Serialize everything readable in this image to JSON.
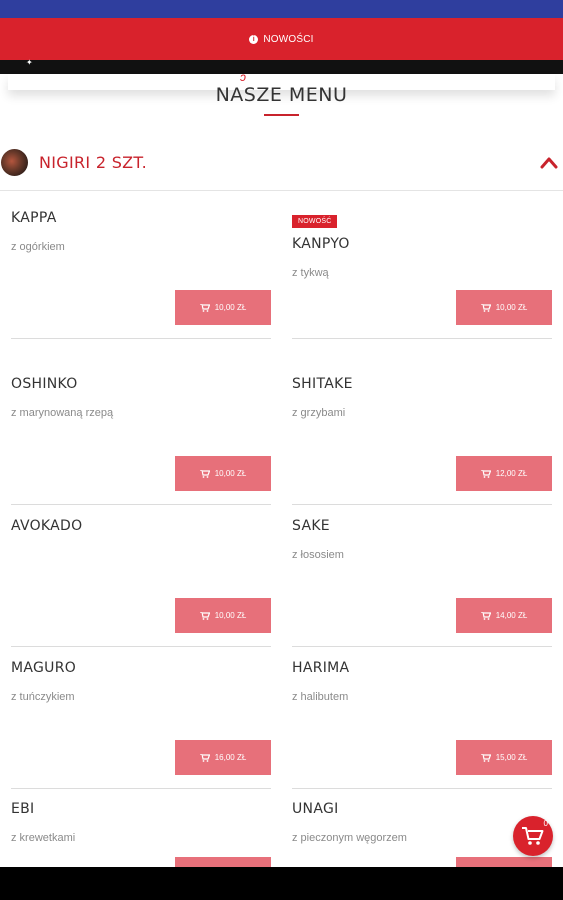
{
  "notice": {
    "text": "NOWOŚCI",
    "icon": "info-icon"
  },
  "header": {
    "title": "NASZE MENU"
  },
  "section": {
    "title": "NIGIRI 2 SZT.",
    "expanded": true
  },
  "items": [
    {
      "name": "KAPPA",
      "desc": "z ogórkiem",
      "price": "10,00 ZŁ",
      "badge": ""
    },
    {
      "name": "KANPYO",
      "desc": "z tykwą",
      "price": "10,00 ZŁ",
      "badge": "NOWOŚĆ"
    },
    {
      "name": "OSHINKO",
      "desc": "z marynowaną rzepą",
      "price": "10,00 ZŁ",
      "badge": ""
    },
    {
      "name": "SHITAKE",
      "desc": "z grzybami",
      "price": "12,00 ZŁ",
      "badge": ""
    },
    {
      "name": "AVOKADO",
      "desc": "",
      "price": "10,00 ZŁ",
      "badge": ""
    },
    {
      "name": "SAKE",
      "desc": "z łososiem",
      "price": "14,00 ZŁ",
      "badge": ""
    },
    {
      "name": "MAGURO",
      "desc": "z tuńczykiem",
      "price": "16,00 ZŁ",
      "badge": ""
    },
    {
      "name": "HARIMA",
      "desc": "z halibutem",
      "price": "15,00 ZŁ",
      "badge": ""
    },
    {
      "name": "EBI",
      "desc": "z krewetkami",
      "price": "",
      "badge": ""
    },
    {
      "name": "UNAGI",
      "desc": "z pieczonym węgorzem",
      "price": "",
      "badge": ""
    }
  ],
  "cart": {
    "count": "0"
  },
  "colors": {
    "brand_red": "#d9222c",
    "button_pink": "#e7707a",
    "status_blue": "#2f3e9e"
  }
}
